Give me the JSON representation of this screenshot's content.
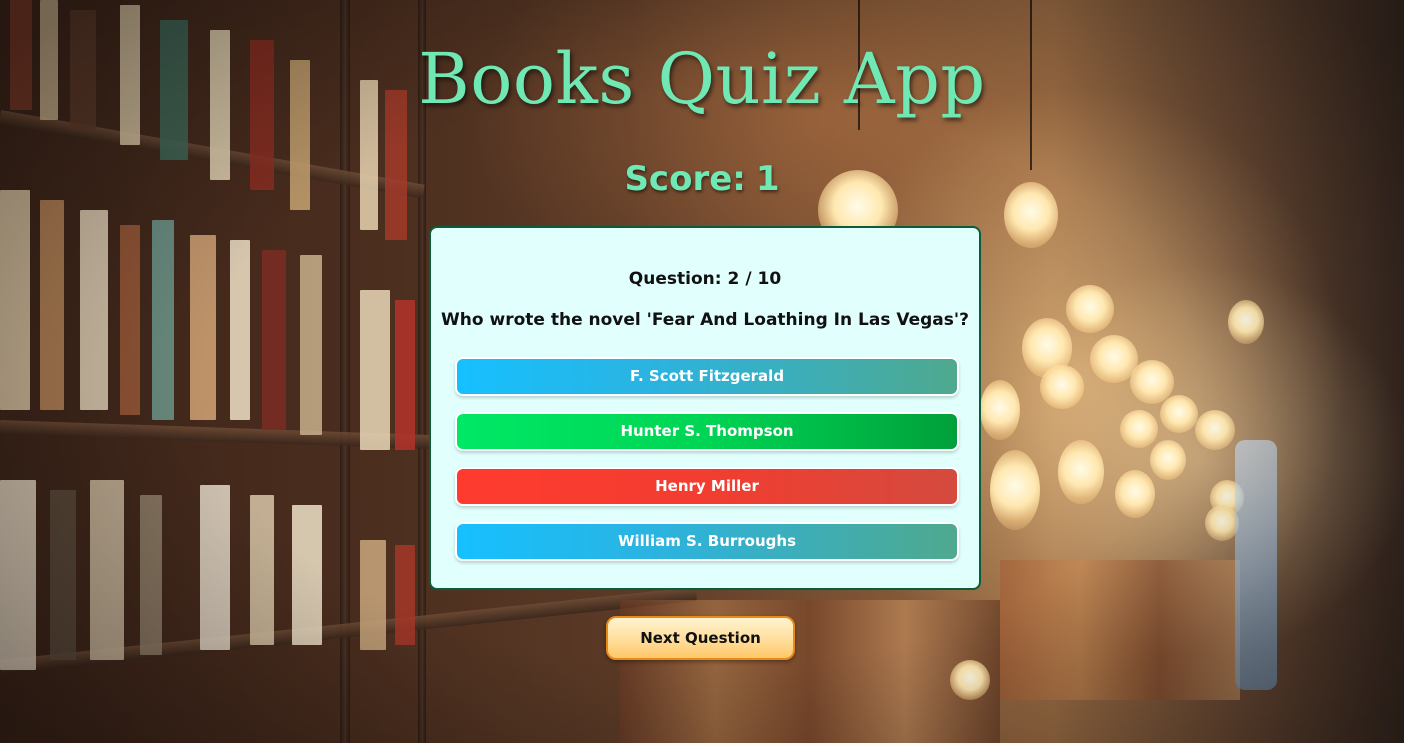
{
  "app": {
    "title": "Books Quiz App",
    "background_image": "library-bookshelves"
  },
  "score": {
    "label": "Score:",
    "value": "1"
  },
  "question": {
    "label": "Question:",
    "current": "2",
    "separator": "/",
    "total": "10",
    "text": "Who wrote the novel 'Fear And Loathing In Las Vegas'?"
  },
  "answers": [
    {
      "label": "F. Scott Fitzgerald",
      "state": "neutral"
    },
    {
      "label": "Hunter S. Thompson",
      "state": "correct"
    },
    {
      "label": "Henry Miller",
      "state": "wrong"
    },
    {
      "label": "William S. Burroughs",
      "state": "neutral"
    }
  ],
  "next_button": {
    "label": "Next Question"
  },
  "colors": {
    "title": "#6fe8b4",
    "card_background": "#e0fffd",
    "card_border": "#0b5c3a",
    "neutral_answer": "#16c0ff",
    "correct_answer": "#00d454",
    "wrong_answer": "#f23d30",
    "next_button": "#ffc86a"
  }
}
